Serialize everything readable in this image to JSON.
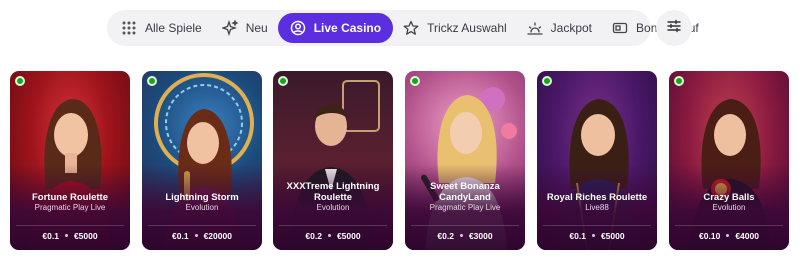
{
  "nav": {
    "items": [
      {
        "label": "Alle Spiele",
        "icon": "grid-icon"
      },
      {
        "label": "Neu",
        "icon": "sparkle-icon"
      },
      {
        "label": "Live Casino",
        "icon": "user-circle-icon",
        "active": true
      },
      {
        "label": "Trickz Auswahl",
        "icon": "star-icon"
      },
      {
        "label": "Jackpot",
        "icon": "sunrise-icon"
      },
      {
        "label": "Bonus-Kauf",
        "icon": "ticket-icon"
      }
    ],
    "filter_icon": "sliders-icon",
    "accent": "#5b2ee0"
  },
  "games": [
    {
      "title": "Fortune Roulette",
      "provider": "Pragmatic Play Live",
      "min": "€0.1",
      "max": "€5000"
    },
    {
      "title": "Lightning Storm",
      "provider": "Evolution",
      "min": "€0.1",
      "max": "€20000"
    },
    {
      "title": "XXXTreme Lightning Roulette",
      "provider": "Evolution",
      "min": "€0.2",
      "max": "€5000"
    },
    {
      "title": "Sweet Bonanza CandyLand",
      "provider": "Pragmatic Play Live",
      "min": "€0.2",
      "max": "€3000"
    },
    {
      "title": "Royal Riches Roulette",
      "provider": "Live88",
      "min": "€0.1",
      "max": "€5000"
    },
    {
      "title": "Crazy Balls",
      "provider": "Evolution",
      "min": "€0.10",
      "max": "€4000"
    }
  ]
}
